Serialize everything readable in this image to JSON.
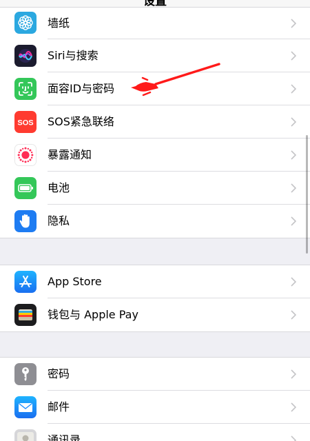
{
  "header": {
    "title": "设置"
  },
  "groups": [
    {
      "rows": [
        {
          "label": "墙纸",
          "icon": "wallpaper-icon",
          "color": "#2ba8e0"
        },
        {
          "label": "Siri与搜索",
          "icon": "siri-icon",
          "color": "#1b1b2e"
        },
        {
          "label": "面容ID与密码",
          "icon": "face-id-icon",
          "color": "#34c759"
        },
        {
          "label": "SOS紧急联络",
          "icon": "sos-icon",
          "color": "#ff3b30",
          "icon_text": "SOS"
        },
        {
          "label": "暴露通知",
          "icon": "exposure-notification-icon",
          "color": "#ffffff"
        },
        {
          "label": "电池",
          "icon": "battery-icon",
          "color": "#34c759"
        },
        {
          "label": "隐私",
          "icon": "privacy-hand-icon",
          "color": "#1e7cf2"
        }
      ]
    },
    {
      "rows": [
        {
          "label": "App Store",
          "icon": "app-store-icon",
          "color": "#1a8cff"
        },
        {
          "label": "钱包与 Apple Pay",
          "icon": "wallet-icon",
          "color": "#1c1c1e"
        }
      ]
    },
    {
      "rows": [
        {
          "label": "密码",
          "icon": "key-icon",
          "color": "#8e8e93"
        },
        {
          "label": "邮件",
          "icon": "mail-icon",
          "color": "#1a8cff"
        },
        {
          "label": "通讯录",
          "icon": "contacts-icon",
          "color": "#c7c7cc"
        }
      ]
    }
  ],
  "annotation": {
    "arrow_color": "#ff1a1a"
  }
}
